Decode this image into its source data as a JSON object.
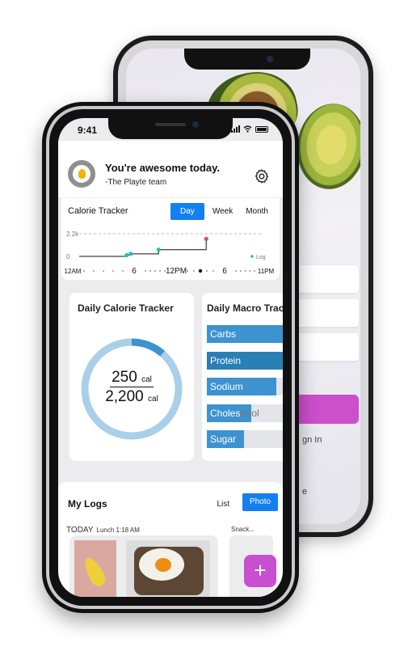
{
  "status": {
    "time": "9:41"
  },
  "header": {
    "title": "You're awesome today.",
    "subtitle": "-The Playte team"
  },
  "calorie_tracker": {
    "title": "Calorie Tracker",
    "tabs": [
      {
        "label": "Day",
        "selected": true
      },
      {
        "label": "Week",
        "selected": false
      },
      {
        "label": "Month",
        "selected": false
      }
    ],
    "y_labels": [
      "2.2k",
      "0"
    ],
    "x_labels": [
      "12AM",
      "6",
      "12PM",
      "6",
      "11PM"
    ],
    "legend": "Log",
    "colors": {
      "line": "#111111",
      "point": "#2bbfb2",
      "last_point": "#e0457b",
      "accent": "#1380f1"
    }
  },
  "chart_data": {
    "type": "line",
    "title": "Calorie Tracker",
    "xlabel": "",
    "ylabel": "",
    "ylim": [
      0,
      2200
    ],
    "reference_line": 2200,
    "x_ticks": [
      "12AM",
      "6",
      "12PM",
      "6",
      "11PM"
    ],
    "series": [
      {
        "name": "Log",
        "x": [
          "6:00",
          "6:30",
          "10:00",
          "16:00"
        ],
        "values": [
          120,
          250,
          650,
          1700
        ]
      }
    ]
  },
  "daily_calorie": {
    "title": "Daily Calorie Tracker",
    "consumed": "250",
    "goal": "2,200",
    "unit": "cal",
    "progress_fraction": 0.114,
    "colors": {
      "track": "#a9cfe9",
      "progress": "#3d93d0"
    }
  },
  "daily_macro": {
    "title": "Daily Macro Tracker",
    "items": [
      {
        "label": "Carbs",
        "fill": 1.0
      },
      {
        "label": "Protein",
        "fill": 1.0
      },
      {
        "label": "Sodium",
        "fill": 0.78
      },
      {
        "label": "Choles",
        "label_rest": "terol",
        "fill": 0.5
      },
      {
        "label": "Sugar",
        "fill": 0.42
      }
    ]
  },
  "logs": {
    "title": "My Logs",
    "view_list": "List",
    "view_photo": "Photo",
    "today": "TODAY",
    "lunch": "Lunch 1:18 AM",
    "snack": "Snack...",
    "fab": "+"
  },
  "back_phone": {
    "sign_in": "gn In",
    "other": "e"
  }
}
